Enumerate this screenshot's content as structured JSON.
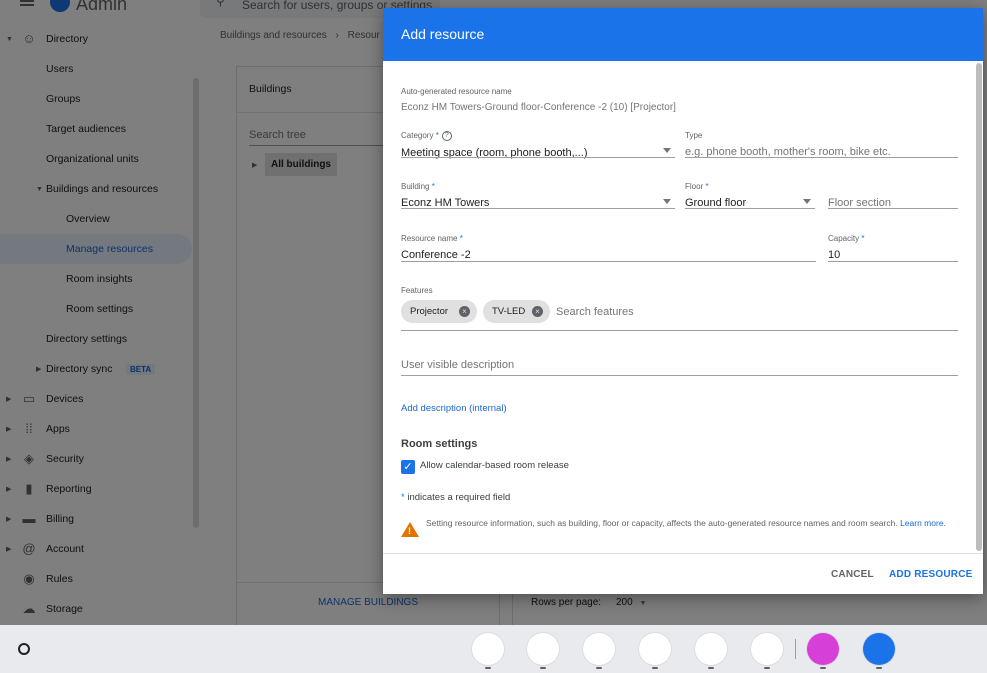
{
  "app": {
    "name": "Admin",
    "search_placeholder": "Search for users, groups or settings"
  },
  "nav": {
    "items": [
      {
        "label": "Directory",
        "level": 0,
        "icon": "person-icon",
        "arrow": "down"
      },
      {
        "label": "Users",
        "level": 1
      },
      {
        "label": "Groups",
        "level": 1
      },
      {
        "label": "Target audiences",
        "level": 1
      },
      {
        "label": "Organizational units",
        "level": 1
      },
      {
        "label": "Buildings and resources",
        "level": 1,
        "arrow": "down"
      },
      {
        "label": "Overview",
        "level": 2
      },
      {
        "label": "Manage resources",
        "level": 2,
        "active": true
      },
      {
        "label": "Room insights",
        "level": 2
      },
      {
        "label": "Room settings",
        "level": 2
      },
      {
        "label": "Directory settings",
        "level": 1
      },
      {
        "label": "Directory sync",
        "level": 1,
        "arrow": "right",
        "badge": "BETA"
      },
      {
        "label": "Devices",
        "level": 0,
        "icon": "devices-icon",
        "arrow": "right"
      },
      {
        "label": "Apps",
        "level": 0,
        "icon": "apps-grid-icon",
        "arrow": "right"
      },
      {
        "label": "Security",
        "level": 0,
        "icon": "shield-icon",
        "arrow": "right"
      },
      {
        "label": "Reporting",
        "level": 0,
        "icon": "bar-chart-icon",
        "arrow": "right"
      },
      {
        "label": "Billing",
        "level": 0,
        "icon": "credit-card-icon",
        "arrow": "right"
      },
      {
        "label": "Account",
        "level": 0,
        "icon": "at-sign-icon",
        "arrow": "right"
      },
      {
        "label": "Rules",
        "level": 0,
        "icon": "rules-icon"
      },
      {
        "label": "Storage",
        "level": 0,
        "icon": "cloud-icon"
      }
    ]
  },
  "breadcrumb": {
    "item1": "Buildings and resources",
    "sep": "›",
    "item2": "Resour"
  },
  "buildings_panel": {
    "title": "Buildings",
    "search_placeholder": "Search tree",
    "all_buildings": "All buildings",
    "manage_button": "MANAGE BUILDINGS"
  },
  "pagination": {
    "rows_per_page_label": "Rows per page:",
    "rows_per_page_value": "200"
  },
  "dialog": {
    "title": "Add resource",
    "auto_name_label": "Auto-generated resource name",
    "auto_name_value": "Econz HM Towers-Ground floor-Conference -2 (10) [Projector]",
    "category_label": "Category",
    "category_value": "Meeting space (room, phone booth,...)",
    "type_label": "Type",
    "type_placeholder": "e.g. phone booth, mother's room, bike etc.",
    "building_label": "Building",
    "building_value": "Econz HM Towers",
    "floor_label": "Floor",
    "floor_value": "Ground floor",
    "floor_section_placeholder": "Floor section",
    "resource_name_label": "Resource name",
    "resource_name_value": "Conference -2",
    "capacity_label": "Capacity",
    "capacity_value": "10",
    "features_label": "Features",
    "features": [
      "Projector",
      "TV-LED"
    ],
    "features_search_placeholder": "Search features",
    "description_placeholder": "User visible description",
    "add_description_link": "Add description (internal)",
    "room_settings_title": "Room settings",
    "allow_release_label": "Allow calendar-based room release",
    "required_star": "*",
    "required_note": "indicates a required field",
    "notice_text": "Setting resource information, such as building, floor or capacity, affects the auto-generated resource names and room search.",
    "learn_more": "Learn more.",
    "cancel_button": "CANCEL",
    "add_button": "ADD RESOURCE"
  },
  "shelf": {
    "apps": [
      {
        "name": "play-store-icon",
        "color": "#ffffff"
      },
      {
        "name": "chrome-icon",
        "color": "#ffffff"
      },
      {
        "name": "photos-icon",
        "color": "#ffffff"
      },
      {
        "name": "gmail-icon",
        "color": "#ffffff"
      },
      {
        "name": "docs-icon",
        "color": "#ffffff"
      },
      {
        "name": "youtube-icon",
        "color": "#ffffff"
      },
      {
        "name": "sparkle-app-icon",
        "color": "#d63fd8"
      },
      {
        "name": "files-icon",
        "color": "#1a73e8"
      }
    ]
  }
}
